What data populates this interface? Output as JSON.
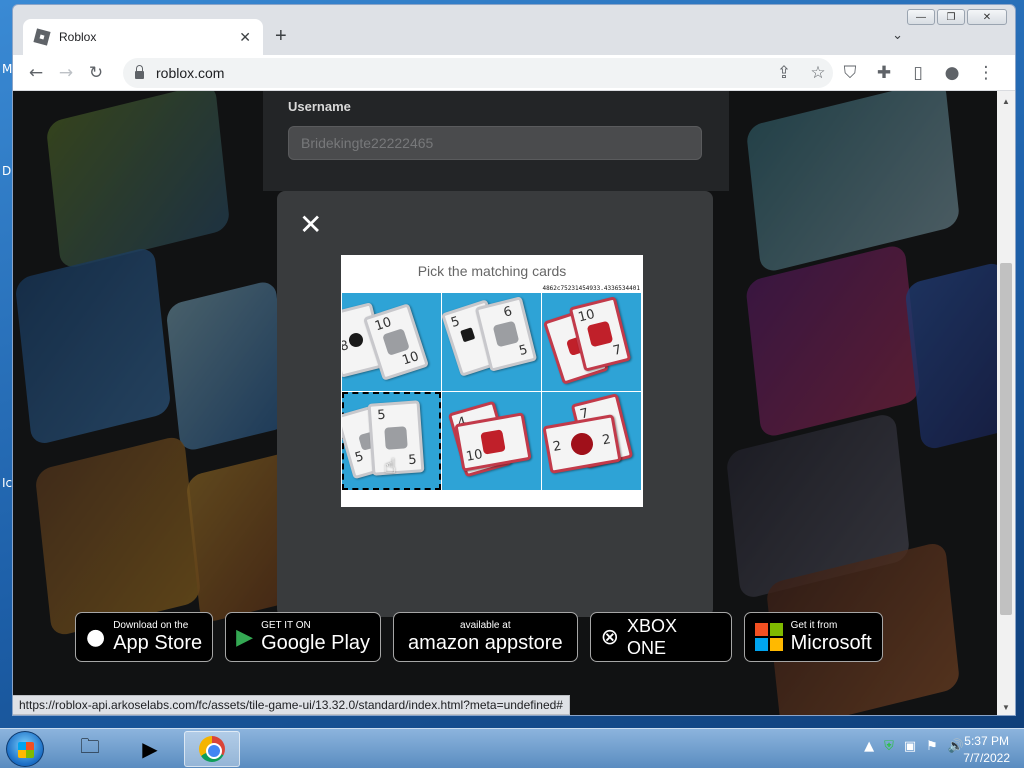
{
  "desktop": {
    "glyph_m": "M",
    "glyph_d": "D",
    "glyph_i": "Ic"
  },
  "window": {
    "minimize": "—",
    "maximize": "❐",
    "close": "✕"
  },
  "tab": {
    "title": "Roblox",
    "close": "✕",
    "new_tab": "+",
    "tab_menu": "⌄"
  },
  "toolbar": {
    "back": "←",
    "forward": "→",
    "reload": "↻",
    "url": "roblox.com",
    "share": "⇪",
    "star": "☆",
    "shield": "⛉",
    "extensions": "✚",
    "sidepanel": "▯",
    "profile": "●",
    "menu": "⋮"
  },
  "page": {
    "username_label": "Username",
    "username_value": "Bridekingte22222465"
  },
  "modal": {
    "close": "✕",
    "captcha_title": "Pick the matching cards",
    "captcha_id": "4862c75231454933.4336534401"
  },
  "cards": {
    "c1a": "8",
    "c1b": "10",
    "c1c": "10",
    "c2a": "5",
    "c2b": "6",
    "c2c": "5",
    "c3a": "10",
    "c3b": "7",
    "c4a": "5",
    "c4b": "5",
    "c4c": "5",
    "c5a": "4",
    "c5b": "10",
    "c5c": "10",
    "c6a": "7",
    "c6b": "2",
    "c6c": "2"
  },
  "stores": {
    "apple_small": "Download on the",
    "apple_big": "App Store",
    "google_small": "GET IT ON",
    "google_big": "Google Play",
    "amazon_small": "available at",
    "amazon_big": "amazon appstore",
    "xbox": "XBOX ONE",
    "ms_small": "Get it from",
    "ms_big": "Microsoft"
  },
  "statusbar": "https://roblox-api.arkoselabs.com/fc/assets/tile-game-ui/13.32.0/standard/index.html?meta=undefined#",
  "taskbar": {
    "time": "5:37 PM",
    "date": "7/7/2022",
    "tray_icons": [
      "▲",
      "⛨",
      "▣",
      "⚑",
      "🔊"
    ]
  },
  "colors": {
    "captcha_bg": "#2ea3d6",
    "modal_bg": "#393b3d",
    "card_red": "#c0202a"
  }
}
